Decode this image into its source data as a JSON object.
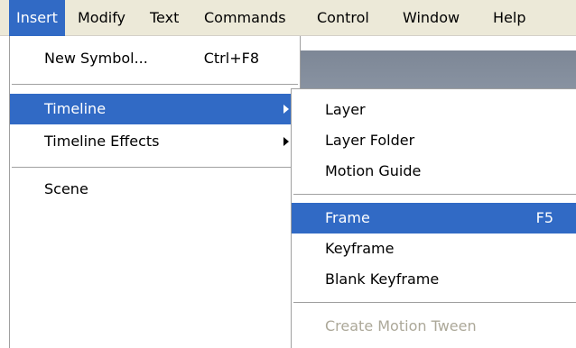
{
  "menubar": {
    "items": [
      {
        "label": "Insert"
      },
      {
        "label": "Modify"
      },
      {
        "label": "Text"
      },
      {
        "label": "Commands"
      },
      {
        "label": "Control"
      },
      {
        "label": "Window"
      },
      {
        "label": "Help"
      }
    ]
  },
  "insert_menu": {
    "new_symbol": {
      "label": "New Symbol...",
      "shortcut": "Ctrl+F8"
    },
    "timeline": {
      "label": "Timeline"
    },
    "timeline_effects": {
      "label": "Timeline Effects"
    },
    "scene": {
      "label": "Scene"
    }
  },
  "timeline_submenu": {
    "layer": {
      "label": "Layer"
    },
    "layer_folder": {
      "label": "Layer Folder"
    },
    "motion_guide": {
      "label": "Motion Guide"
    },
    "frame": {
      "label": "Frame",
      "shortcut": "F5"
    },
    "keyframe": {
      "label": "Keyframe"
    },
    "blank_keyframe": {
      "label": "Blank Keyframe"
    },
    "create_motion_tween": {
      "label": "Create Motion Tween",
      "disabled": true
    }
  },
  "colors": {
    "highlight": "#316ac5",
    "menubar_bg": "#ece9d8",
    "disabled_text": "#aca899"
  }
}
